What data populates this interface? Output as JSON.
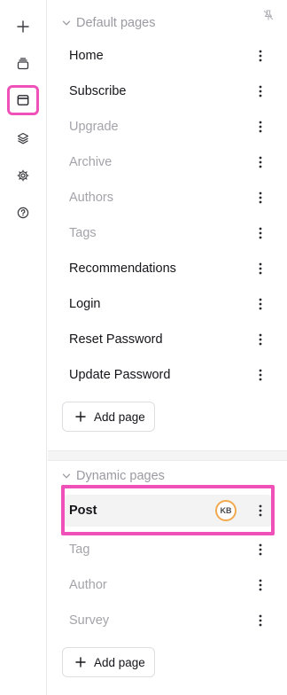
{
  "rail": {
    "items": [
      {
        "icon": "plus-icon"
      },
      {
        "icon": "stack-icon"
      },
      {
        "icon": "browser-window-icon",
        "active": true
      },
      {
        "icon": "layers-icon"
      },
      {
        "icon": "gear-icon"
      },
      {
        "icon": "help-circle-icon"
      }
    ]
  },
  "default_section": {
    "title": "Default pages",
    "pages": [
      {
        "label": "Home",
        "muted": false
      },
      {
        "label": "Subscribe",
        "muted": false
      },
      {
        "label": "Upgrade",
        "muted": true
      },
      {
        "label": "Archive",
        "muted": true
      },
      {
        "label": "Authors",
        "muted": true
      },
      {
        "label": "Tags",
        "muted": true
      },
      {
        "label": "Recommendations",
        "muted": false
      },
      {
        "label": "Login",
        "muted": false
      },
      {
        "label": "Reset Password",
        "muted": false
      },
      {
        "label": "Update Password",
        "muted": false
      }
    ],
    "add_label": "Add page"
  },
  "dynamic_section": {
    "title": "Dynamic pages",
    "pages": [
      {
        "label": "Post",
        "muted": false,
        "selected": true,
        "avatar": "KB"
      },
      {
        "label": "Tag",
        "muted": true
      },
      {
        "label": "Author",
        "muted": true
      },
      {
        "label": "Survey",
        "muted": true
      }
    ],
    "add_label": "Add page"
  },
  "colors": {
    "highlight": "#f051b9",
    "avatar_ring": "#f2a94e",
    "muted_text": "#a3a3aa"
  }
}
